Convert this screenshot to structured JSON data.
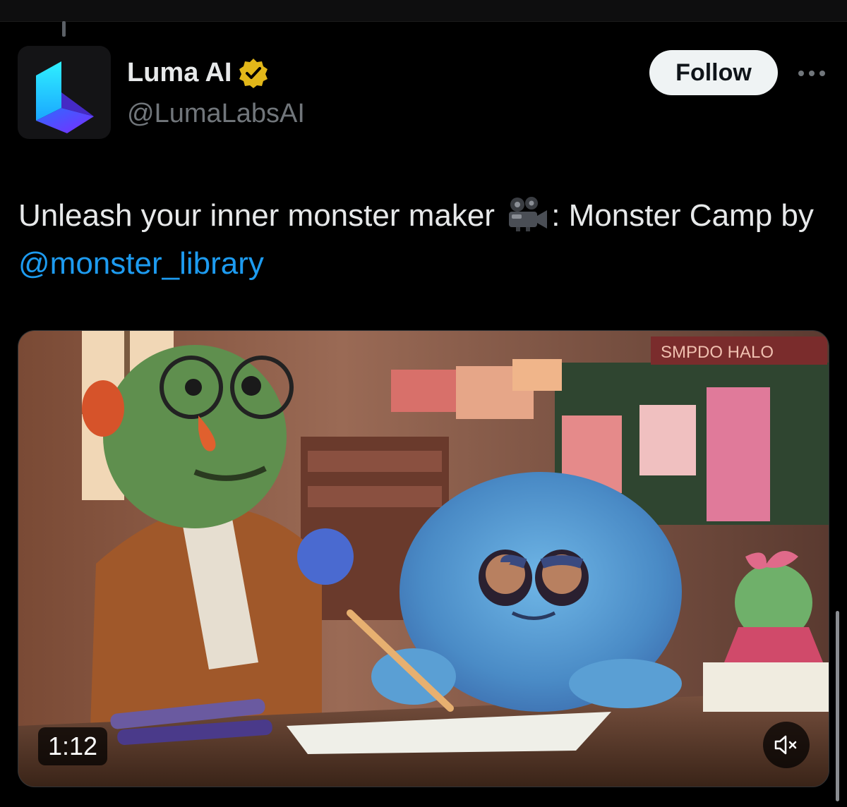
{
  "post": {
    "author": {
      "display_name": "Luma AI",
      "handle": "@LumaLabsAI",
      "verified_badge": "verified-badge-gold",
      "avatar_icon": "luma-logo"
    },
    "follow_label": "Follow",
    "more_icon": "ellipsis-icon",
    "text": {
      "part1": "Unleash your inner monster maker",
      "emoji": "movie-camera-emoji",
      "part2": ": Monster Camp by",
      "mention": "@monster_library"
    },
    "media": {
      "type": "video",
      "duration": "1:12",
      "mute_icon": "speaker-muted-icon",
      "chalkboard_text": "SMPDO HALO"
    }
  },
  "colors": {
    "background": "#000000",
    "text_primary": "#e7e9ea",
    "text_secondary": "#71767b",
    "link": "#1d9bf0",
    "follow_bg": "#eff3f4",
    "badge_gold": "#e2b719"
  }
}
